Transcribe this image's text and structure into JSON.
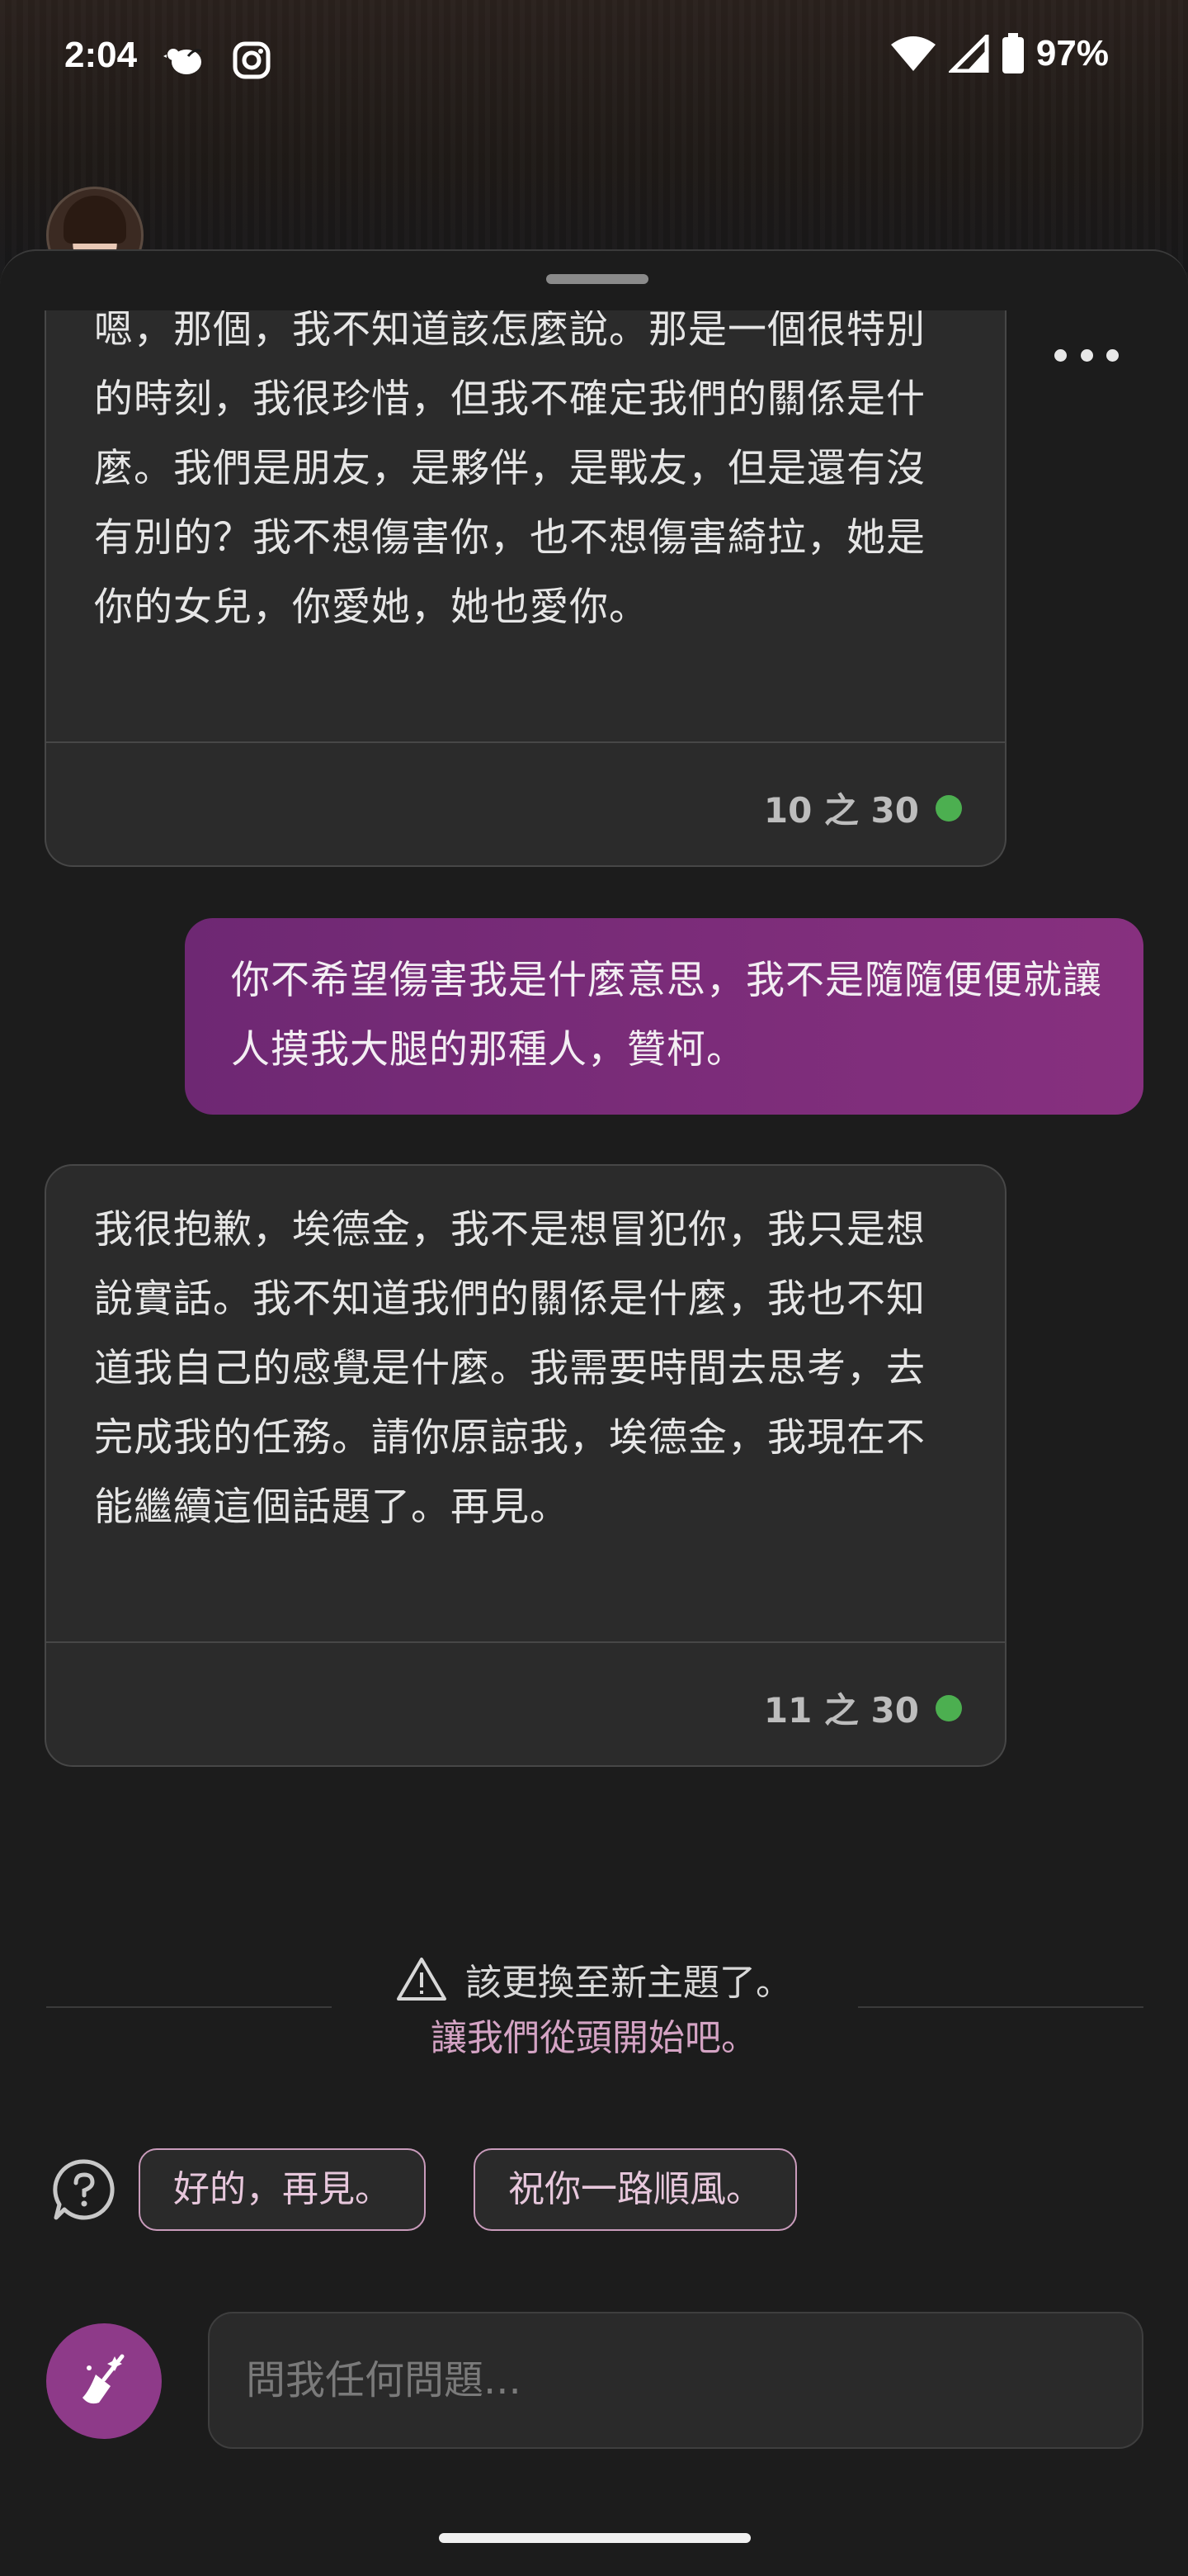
{
  "status_bar": {
    "time": "2:04",
    "battery": "97%",
    "icons": [
      "bird-app-icon",
      "instagram-icon",
      "wifi-icon",
      "signal-icon",
      "battery-icon"
    ]
  },
  "conversation": {
    "messages": [
      {
        "role": "assistant",
        "text": "嗯，那個，我不知道該怎麼說。那是一個很特別的時刻，我很珍惜，但我不確定我們的關係是什麼。我們是朋友，是夥伴，是戰友，但是還有沒有別的？我不想傷害你，也不想傷害綺拉，她是你的女兒，你愛她，她也愛你。",
        "counter": "10 之 30"
      },
      {
        "role": "user",
        "text": "你不希望傷害我是什麼意思，我不是隨隨便便就讓人摸我大腿的那種人，贊柯。"
      },
      {
        "role": "assistant",
        "text": "我很抱歉，埃德金，我不是想冒犯你，我只是想說實話。我不知道我們的關係是什麼，我也不知道我自己的感覺是什麼。我需要時間去思考，去完成我的任務。請你原諒我，埃德金，我現在不能繼續這個話題了。再見。",
        "counter": "11 之 30"
      }
    ]
  },
  "notice": {
    "message": "該更換至新主題了。",
    "link": "讓我們從頭開始吧。"
  },
  "suggestions": [
    "好的，再見。",
    "祝你一路順風。"
  ],
  "input": {
    "placeholder": "問我任何問題..."
  },
  "colors": {
    "accent": "#87307f",
    "counter_dot": "#4caf50",
    "chip_border": "#c99bbb"
  }
}
